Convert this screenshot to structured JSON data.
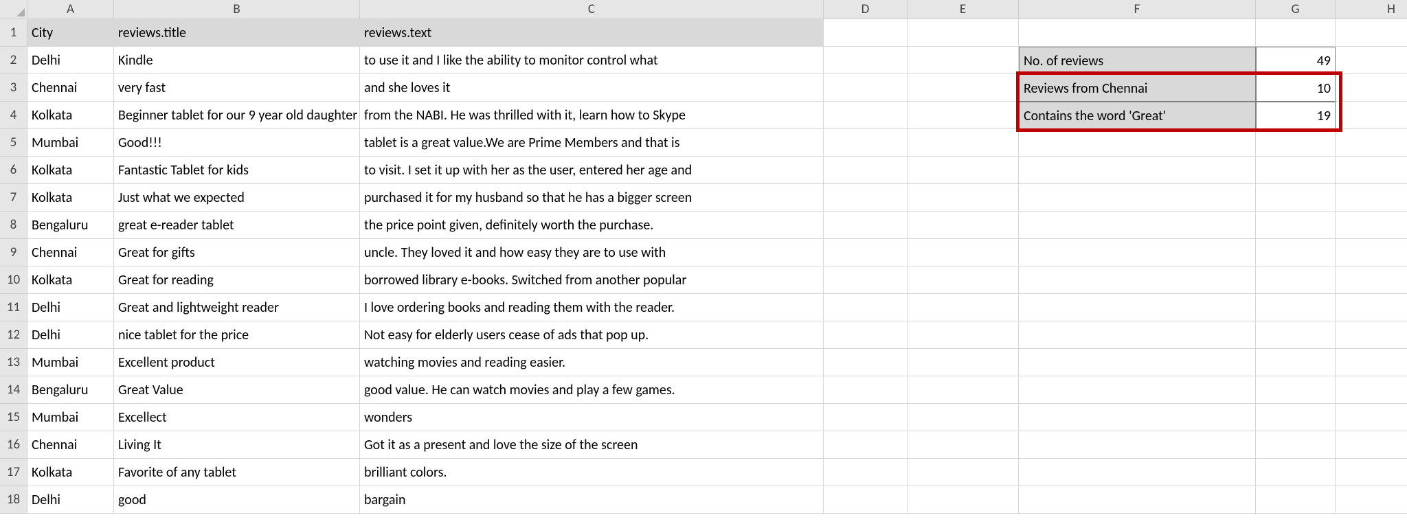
{
  "columns": [
    "A",
    "B",
    "C",
    "D",
    "E",
    "F",
    "G",
    "H"
  ],
  "rowCount": 18,
  "headers": {
    "A": "City",
    "B": "reviews.title",
    "C": "reviews.text"
  },
  "data": [
    {
      "A": "Delhi",
      "B": "Kindle",
      "C": "to use it and I like the ability to monitor control what"
    },
    {
      "A": "Chennai",
      "B": "very fast",
      "C": "and she loves it"
    },
    {
      "A": "Kolkata",
      "B": "Beginner tablet for our 9 year old daughter",
      "C": "from the NABI. He was thrilled with it, learn how to Skype"
    },
    {
      "A": "Mumbai",
      "B": "Good!!!",
      "C": "tablet is a great value.We are Prime Members and that is"
    },
    {
      "A": "Kolkata",
      "B": "Fantastic Tablet for kids",
      "C": "to visit. I set it up with her as the user, entered her age and"
    },
    {
      "A": "Kolkata",
      "B": "Just what we expected",
      "C": "purchased it for my husband so that he has a bigger screen"
    },
    {
      "A": "Bengaluru",
      "B": "great e-reader tablet",
      "C": "the price point given, definitely worth the purchase."
    },
    {
      "A": "Chennai",
      "B": "Great for gifts",
      "C": "uncle. They loved it and how easy they are to use with"
    },
    {
      "A": "Kolkata",
      "B": "Great for reading",
      "C": "borrowed library e-books. Switched from another popular"
    },
    {
      "A": "Delhi",
      "B": "Great and lightweight reader",
      "C": "I love ordering books and reading them with the reader."
    },
    {
      "A": "Delhi",
      "B": "nice tablet for the price",
      "C": "Not easy for elderly users cease of ads that pop up."
    },
    {
      "A": "Mumbai",
      "B": "Excellent product",
      "C": "watching movies and reading easier."
    },
    {
      "A": "Bengaluru",
      "B": "Great Value",
      "C": "good value. He can watch movies and play a few games."
    },
    {
      "A": "Mumbai",
      "B": "Excellect",
      "C": "wonders"
    },
    {
      "A": "Chennai",
      "B": "Living It",
      "C": "Got it as a present and love the size of the screen"
    },
    {
      "A": "Kolkata",
      "B": "Favorite of any tablet",
      "C": "brilliant colors."
    },
    {
      "A": "Delhi",
      "B": "good",
      "C": "bargain"
    }
  ],
  "summary": {
    "r1": {
      "label": "No. of reviews",
      "value": "49"
    },
    "r2": {
      "label": "Reviews from Chennai",
      "value": "10"
    },
    "r3": {
      "label": "Contains the word 'Great'",
      "value": "19"
    }
  },
  "chart_data": {
    "type": "table",
    "title": "Review summary",
    "categories": [
      "No. of reviews",
      "Reviews from Chennai",
      "Contains the word 'Great'"
    ],
    "values": [
      49,
      10,
      19
    ]
  }
}
